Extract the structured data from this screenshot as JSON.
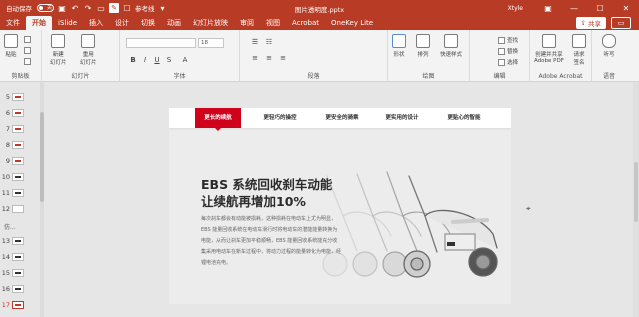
{
  "titlebar": {
    "autosave_label": "自动保存",
    "autosave_state": "关",
    "reviewer_label": "参考线",
    "doc_title": "图片透明度.pptx",
    "user": "Xtyle",
    "minimize": "—",
    "maximize": "☐",
    "close": "✕"
  },
  "tabs": [
    {
      "label": "文件",
      "active": false
    },
    {
      "label": "开始",
      "active": true
    },
    {
      "label": "iSlide",
      "active": false
    },
    {
      "label": "插入",
      "active": false
    },
    {
      "label": "设计",
      "active": false
    },
    {
      "label": "切换",
      "active": false
    },
    {
      "label": "动画",
      "active": false
    },
    {
      "label": "幻灯片放映",
      "active": false
    },
    {
      "label": "审阅",
      "active": false
    },
    {
      "label": "视图",
      "active": false
    },
    {
      "label": "Acrobat",
      "active": false
    },
    {
      "label": "OneKey Lite",
      "active": false
    }
  ],
  "share_label": "共享",
  "ribbon": {
    "clipboard": {
      "paste": "粘贴",
      "group": "剪贴板"
    },
    "slides": {
      "new_slide": "新建\n幻灯片",
      "reuse": "重用\n幻灯片",
      "group": "幻灯片"
    },
    "font": {
      "size": "18",
      "group": "字体",
      "bold": "B",
      "italic": "I",
      "underline": "U",
      "strike": "S"
    },
    "paragraph": {
      "group": "段落"
    },
    "drawing": {
      "shape": "形状",
      "arrange": "排列",
      "quick_styles": "快速样式",
      "group": "绘图"
    },
    "editing": {
      "find": "查找",
      "replace": "替换",
      "select": "选择",
      "group": "编辑"
    },
    "acrobat": {
      "create_share": "创建并共享\nAdobe PDF",
      "request_sign": "请求\n签名",
      "group": "Adobe Acrobat"
    },
    "voice": {
      "dictate": "听写",
      "group": "语音"
    }
  },
  "thumbnails": [
    {
      "num": "5",
      "accent": "#c0392b"
    },
    {
      "num": "6",
      "accent": "#c0392b"
    },
    {
      "num": "7",
      "accent": "#c0392b"
    },
    {
      "num": "8",
      "accent": "#c0392b"
    },
    {
      "num": "9",
      "accent": "#c0392b"
    },
    {
      "num": "10",
      "accent": "#333333"
    },
    {
      "num": "11",
      "accent": "#333333"
    },
    {
      "num": "12",
      "accent": "#ffffff"
    },
    {
      "num": "13",
      "accent": "#333333"
    },
    {
      "num": "14",
      "accent": "#333333"
    },
    {
      "num": "15",
      "accent": "#333333"
    },
    {
      "num": "16",
      "accent": "#333333"
    },
    {
      "num": "17",
      "accent": "#c0392b"
    }
  ],
  "section_label": "仿...",
  "slide": {
    "nav": [
      "更长的续航",
      "更轻巧的操控",
      "更安全的骑乘",
      "更实用的设计",
      "更贴心的智能"
    ],
    "title_line1": "EBS 系统回收刹车动能",
    "title_line2": "让续航再增加10%",
    "body": "每次刹车都会有动能被损耗，这种损耗在电动车上尤为明显，EBS 能量回收系统在电动车滑行时将电动车的潜能能量转换为电能，从而让刹车更加平稳顺畅，EBS 能量回收系统能充分收集采用电动车在新车过程中，将动力过程的能量转化为电能，经锂电池充电。"
  },
  "colors": {
    "brand": "#b83b25",
    "accent_red": "#d0021b"
  }
}
